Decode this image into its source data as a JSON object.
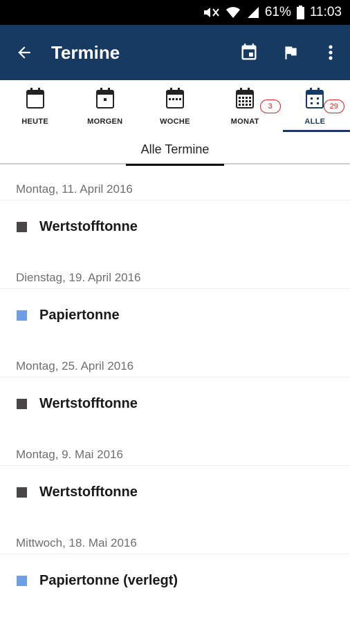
{
  "status_bar": {
    "battery": "61%",
    "time": "11:03"
  },
  "app_bar": {
    "title": "Termine"
  },
  "tabs": [
    {
      "label": "HEUTE",
      "badge": null
    },
    {
      "label": "MORGEN",
      "badge": null
    },
    {
      "label": "WOCHE",
      "badge": null
    },
    {
      "label": "MONAT",
      "badge": "3"
    },
    {
      "label": "ALLE",
      "badge": "29"
    }
  ],
  "active_tab": "ALLE",
  "subheader": "Alle Termine",
  "colors": {
    "app_bar": "#173a63",
    "wertstoff": "#4a4548",
    "papier": "#6e9ee8",
    "badge": "#e02020"
  },
  "entries": [
    {
      "date": "Montag, 11. April 2016",
      "title": "Wertstofftonne",
      "color": "#4a4548"
    },
    {
      "date": "Dienstag, 19. April 2016",
      "title": "Papiertonne",
      "color": "#6e9ee8"
    },
    {
      "date": "Montag, 25. April 2016",
      "title": "Wertstofftonne",
      "color": "#4a4548"
    },
    {
      "date": "Montag, 9. Mai 2016",
      "title": "Wertstofftonne",
      "color": "#4a4548"
    },
    {
      "date": "Mittwoch, 18. Mai 2016",
      "title": "Papiertonne (verlegt)",
      "color": "#6e9ee8"
    }
  ]
}
